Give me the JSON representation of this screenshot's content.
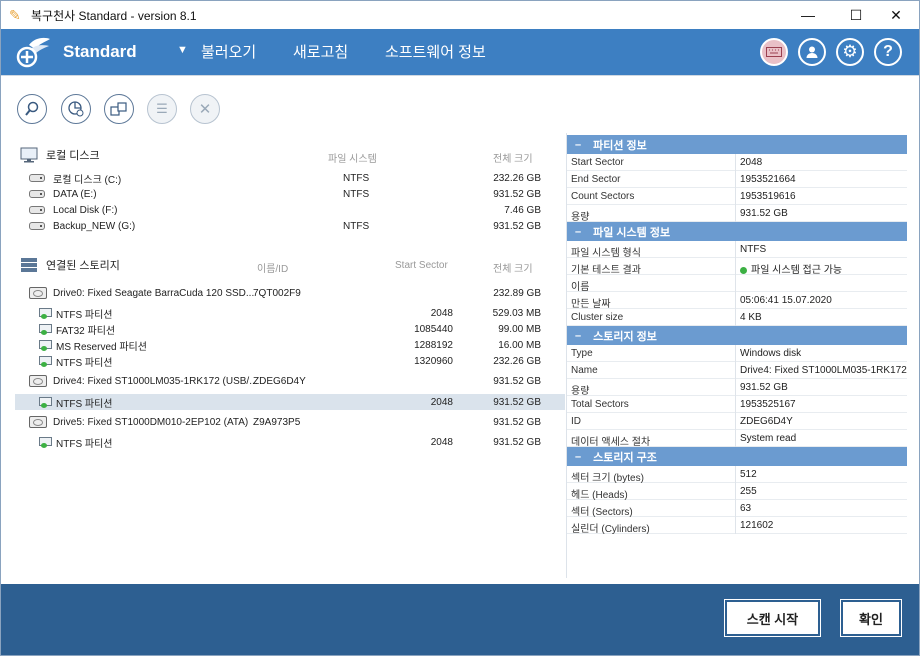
{
  "window": {
    "title": "복구천사 Standard - version 8.1",
    "minimize": "—",
    "maximize": "☐",
    "close": "✕"
  },
  "header": {
    "brand": "Standard",
    "menu": [
      "불러오기",
      "새로고침",
      "소프트웨어 정보"
    ],
    "icons": [
      "keyboard-icon",
      "user-icon",
      "gear-icon",
      "help-icon"
    ]
  },
  "toolbar": {
    "icons": [
      "search-icon",
      "scan-icon",
      "copy-icon",
      "list-icon",
      "close-icon"
    ]
  },
  "local_disks": {
    "title": "로컬 디스크",
    "col_fs": "파일 시스템",
    "col_size": "전체 크기",
    "items": [
      {
        "name": "로컬 디스크 (C:)",
        "fs": "NTFS",
        "size": "232.26 GB"
      },
      {
        "name": "DATA (E:)",
        "fs": "NTFS",
        "size": "931.52 GB"
      },
      {
        "name": "Local Disk (F:)",
        "fs": "",
        "size": "7.46 GB"
      },
      {
        "name": "Backup_NEW (G:)",
        "fs": "NTFS",
        "size": "931.52 GB"
      }
    ]
  },
  "storages": {
    "title": "연결된 스토리지",
    "col_id": "이름/ID",
    "col_start": "Start Sector",
    "col_size": "전체 크기",
    "items": [
      {
        "type": "drive",
        "name": "Drive0: Fixed Seagate BarraCuda 120 SSD...",
        "id": "7QT002F9",
        "start": "",
        "size": "232.89 GB"
      },
      {
        "type": "part",
        "name": "NTFS 파티션",
        "id": "",
        "start": "2048",
        "size": "529.03 MB"
      },
      {
        "type": "part",
        "name": "FAT32 파티션",
        "id": "",
        "start": "1085440",
        "size": "99.00 MB"
      },
      {
        "type": "part",
        "name": "MS Reserved 파티션",
        "id": "",
        "start": "1288192",
        "size": "16.00 MB"
      },
      {
        "type": "part",
        "name": "NTFS 파티션",
        "id": "",
        "start": "1320960",
        "size": "232.26 GB"
      },
      {
        "type": "drive",
        "name": "Drive4: Fixed ST1000LM035-1RK172 (USB/...",
        "id": "ZDEG6D4Y",
        "start": "",
        "size": "931.52 GB"
      },
      {
        "type": "part",
        "name": "NTFS 파티션",
        "id": "",
        "start": "2048",
        "size": "931.52 GB",
        "selected": true
      },
      {
        "type": "drive",
        "name": "Drive5: Fixed ST1000DM010-2EP102 (ATA)",
        "id": "Z9A973P5",
        "start": "",
        "size": "931.52 GB"
      },
      {
        "type": "part",
        "name": "NTFS 파티션",
        "id": "",
        "start": "2048",
        "size": "931.52 GB"
      }
    ]
  },
  "properties": [
    {
      "title": "파티션 정보",
      "rows": [
        [
          "Start Sector",
          "2048"
        ],
        [
          "End Sector",
          "1953521664"
        ],
        [
          "Count Sectors",
          "1953519616"
        ],
        [
          "용량",
          "931.52 GB"
        ]
      ]
    },
    {
      "title": "파일 시스템 정보",
      "rows": [
        [
          "파일 시스템 형식",
          "NTFS"
        ],
        [
          "기본 테스트 결과",
          "파일 시스템 접근 가능"
        ],
        [
          "이름",
          ""
        ],
        [
          "만든 날짜",
          "05:06:41 15.07.2020"
        ],
        [
          "Cluster size",
          "4 KB"
        ]
      ]
    },
    {
      "title": "스토리지 정보",
      "rows": [
        [
          "Type",
          "Windows disk"
        ],
        [
          "Name",
          "Drive4: Fixed ST1000LM035-1RK172"
        ],
        [
          "용량",
          "931.52 GB"
        ],
        [
          "Total Sectors",
          "1953525167"
        ],
        [
          "ID",
          "ZDEG6D4Y"
        ],
        [
          "데이터 액세스 절차",
          "System read"
        ]
      ]
    },
    {
      "title": "스토리지 구조",
      "rows": [
        [
          "섹터 크기 (bytes)",
          "512"
        ],
        [
          "헤드 (Heads)",
          "255"
        ],
        [
          "섹터 (Sectors)",
          "63"
        ],
        [
          "실린더 (Cylinders)",
          "121602"
        ]
      ]
    }
  ],
  "footer": {
    "scan_label": "스캔 시작",
    "ok_label": "확인"
  }
}
